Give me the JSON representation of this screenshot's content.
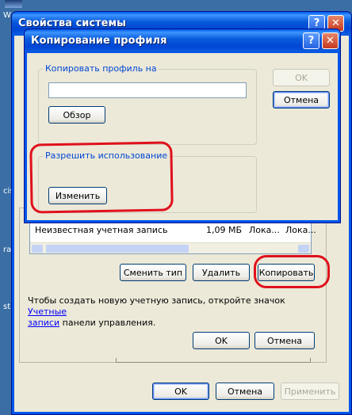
{
  "desktop": {
    "icon_labels": [
      "W",
      "cis",
      "ra",
      "st"
    ]
  },
  "outer_window": {
    "title": "Свойства системы",
    "help_glyph": "?",
    "close_glyph": "✕",
    "ok_label": "OK",
    "cancel_label": "Отмена",
    "apply_label": "Применить"
  },
  "profiles_dialog": {
    "row": {
      "name": "Неизвестная учетная запись",
      "size": "1,09 МБ",
      "type": "Лока...",
      "status": "Лока..."
    },
    "change_type_label": "Сменить тип",
    "delete_label": "Удалить",
    "copy_label": "Копировать",
    "hint_text": "Чтобы создать новую учетную запись, откройте значок",
    "hint_link_1": "Учетные",
    "hint_link_2": "записи",
    "hint_tail": "панели управления.",
    "ok_label": "OK",
    "cancel_label": "Отмена"
  },
  "copy_dialog": {
    "title": "Копирование профиля",
    "help_glyph": "?",
    "close_glyph": "✕",
    "copy_to_group": "Копировать профиль на",
    "path_value": "",
    "browse_label": "Обзор",
    "allow_group": "Разрешить использование",
    "change_label": "Изменить",
    "ok_label": "OK",
    "cancel_label": "Отмена"
  },
  "colors": {
    "xp_blue": "#0054e3",
    "dialog_bg": "#ece9d8",
    "annotation_red": "#e0101c",
    "group_label": "#0046d5"
  }
}
